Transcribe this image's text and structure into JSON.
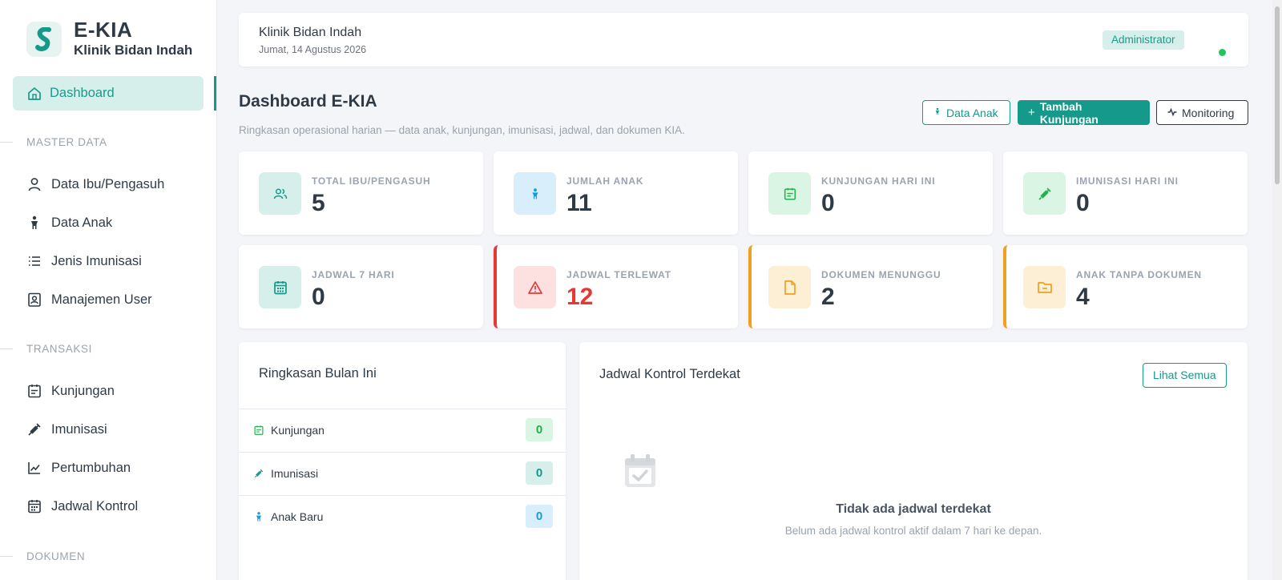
{
  "brand": {
    "title": "E-KIA",
    "subtitle": "Klinik Bidan Indah"
  },
  "sidebar": {
    "active": {
      "label": "Dashboard",
      "icon": "home-icon"
    },
    "sections": [
      {
        "label": "MASTER DATA",
        "items": [
          {
            "label": "Data Ibu/Pengasuh",
            "icon": "user-icon"
          },
          {
            "label": "Data Anak",
            "icon": "child-icon"
          },
          {
            "label": "Jenis Imunisasi",
            "icon": "list-icon"
          },
          {
            "label": "Manajemen User",
            "icon": "id-badge-icon"
          }
        ]
      },
      {
        "label": "TRANSAKSI",
        "items": [
          {
            "label": "Kunjungan",
            "icon": "calendar-check-icon"
          },
          {
            "label": "Imunisasi",
            "icon": "syringe-icon"
          },
          {
            "label": "Pertumbuhan",
            "icon": "chart-line-icon"
          },
          {
            "label": "Jadwal Kontrol",
            "icon": "calendar-icon"
          }
        ]
      },
      {
        "label": "DOKUMEN",
        "items": []
      }
    ]
  },
  "topbar": {
    "title": "Klinik Bidan Indah",
    "date": "Jumat, 14 Agustus 2026",
    "role": "Administrator",
    "status_color": "#22c55e"
  },
  "page": {
    "title": "Dashboard E-KIA",
    "description": "Ringkasan operasional harian — data anak, kunjungan, imunisasi, jadwal, dan dokumen KIA."
  },
  "actions": {
    "data_anak": "Data Anak",
    "tambah_kunjungan": "Tambah Kunjungan",
    "monitoring": "Monitoring"
  },
  "stats": [
    {
      "label": "TOTAL IBU/PENGASUH",
      "value": "5",
      "icon": "users-icon",
      "bg": "#d7efeb",
      "fg": "#15998a"
    },
    {
      "label": "JUMLAH ANAK",
      "value": "11",
      "icon": "child-icon",
      "bg": "#d9eefb",
      "fg": "#1a9ad6"
    },
    {
      "label": "KUNJUNGAN HARI INI",
      "value": "0",
      "icon": "calendar-check-icon",
      "bg": "#daf5e4",
      "fg": "#22b14c"
    },
    {
      "label": "IMUNISASI HARI INI",
      "value": "0",
      "icon": "syringe-icon",
      "bg": "#daf5e4",
      "fg": "#22b14c"
    },
    {
      "label": "JADWAL 7 HARI",
      "value": "0",
      "icon": "calendar-icon",
      "bg": "#d7efeb",
      "fg": "#15998a"
    },
    {
      "label": "JADWAL TERLEWAT",
      "value": "12",
      "icon": "warning-icon",
      "bg": "#fde0e0",
      "fg": "#e53935",
      "value_color": "#e53935"
    },
    {
      "label": "DOKUMEN MENUNGGU",
      "value": "2",
      "icon": "file-icon",
      "bg": "#fdeed6",
      "fg": "#f0a020"
    },
    {
      "label": "ANAK TANPA DOKUMEN",
      "value": "4",
      "icon": "folder-icon",
      "bg": "#fdeed6",
      "fg": "#f0a020"
    }
  ],
  "summary": {
    "title": "Ringkasan Bulan Ini",
    "rows": [
      {
        "label": "Kunjungan",
        "value": "0",
        "icon": "calendar-check-icon",
        "fg": "#22b14c",
        "bg": "#daf5e4"
      },
      {
        "label": "Imunisasi",
        "value": "0",
        "icon": "syringe-icon",
        "fg": "#15998a",
        "bg": "#d7efeb"
      },
      {
        "label": "Anak Baru",
        "value": "0",
        "icon": "child-icon",
        "fg": "#1a9ad6",
        "bg": "#d9eefb"
      }
    ]
  },
  "schedule": {
    "title": "Jadwal Kontrol Terdekat",
    "see_all": "Lihat Semua",
    "empty_title": "Tidak ada jadwal terdekat",
    "empty_desc": "Belum ada jadwal kontrol aktif dalam 7 hari ke depan."
  }
}
